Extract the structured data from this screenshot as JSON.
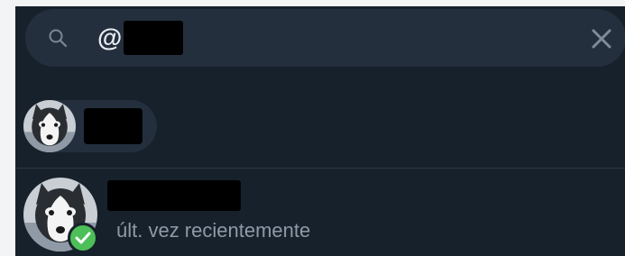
{
  "search": {
    "query_prefix": "@",
    "query_redacted": true
  },
  "chip": {
    "name_redacted": true
  },
  "result": {
    "name_redacted": true,
    "status": "últ. vez recientemente",
    "online": true
  },
  "icons": {
    "search": "search-icon",
    "clear": "close-icon",
    "badge": "checkmark-icon"
  },
  "colors": {
    "background": "#17212b",
    "field": "#242f3d",
    "text": "#e9eef4",
    "muted": "#8d9aa7",
    "badge": "#4dbf58"
  }
}
